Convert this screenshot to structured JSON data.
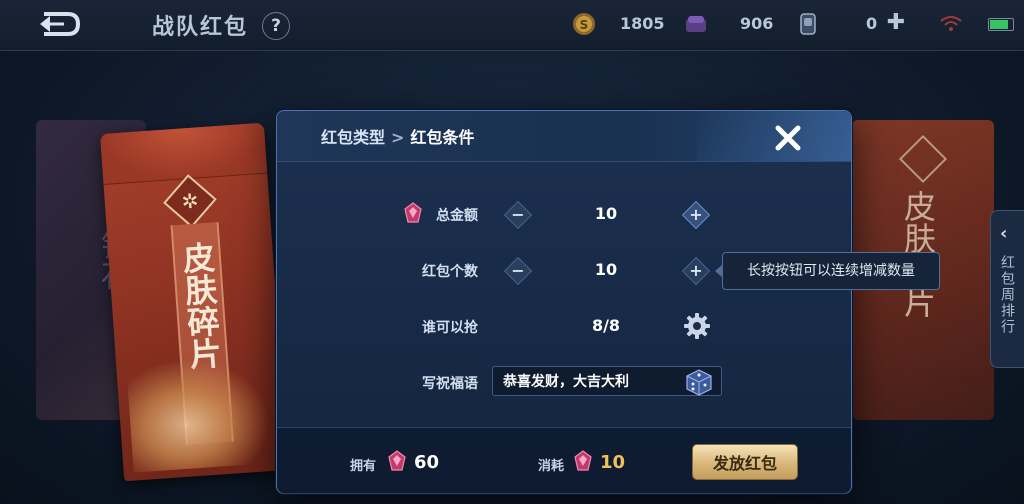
{
  "topbar": {
    "title": "战队红包",
    "help_label": "?",
    "gold": "1805",
    "gems": "906",
    "vouchers": "0",
    "plus_label": "✚"
  },
  "left_envelope": {
    "text": "钻石"
  },
  "main_envelope": {
    "text": "皮肤碎片"
  },
  "right_envelope": {
    "text": "皮肤碎片"
  },
  "rank_tab": {
    "arrow": "‹",
    "label": "红包周排行"
  },
  "dialog": {
    "crumb_parent": "红包类型",
    "crumb_sep": ">",
    "crumb_current": "红包条件",
    "total_label": "总金额",
    "total_value": "10",
    "count_label": "红包个数",
    "count_value": "10",
    "who_label": "谁可以抢",
    "who_value": "8/8",
    "wish_label": "写祝福语",
    "wish_value": "恭喜发财，大吉大利",
    "minus_symbol": "−",
    "plus_symbol": "+",
    "tooltip": "长按按钮可以连续增减数量",
    "own_label": "拥有",
    "own_value": "60",
    "cost_label": "消耗",
    "cost_value": "10",
    "send_label": "发放红包"
  },
  "colors": {
    "accent_gold": "#f0c15a",
    "panel": "#172a47",
    "own_value": "#ffffff"
  }
}
